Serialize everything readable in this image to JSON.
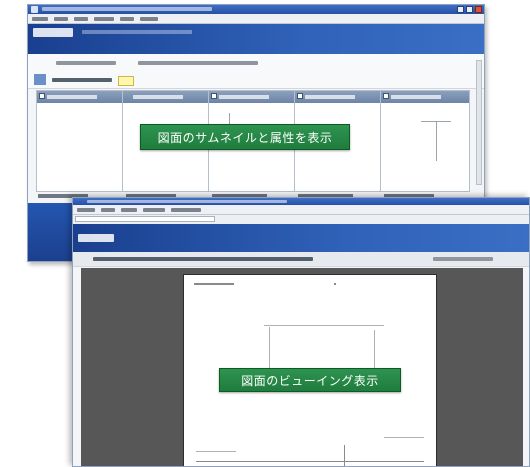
{
  "callouts": {
    "thumbnail": "図面のサムネイルと属性を表示",
    "viewing": "図面のビューイング表示"
  },
  "colors": {
    "callout_bg": "#1f7d3d",
    "banner": "#1a3f8f",
    "viewer_bg": "#575757"
  },
  "icons": [
    "window-minimize-icon",
    "window-maximize-icon",
    "window-close-icon"
  ]
}
